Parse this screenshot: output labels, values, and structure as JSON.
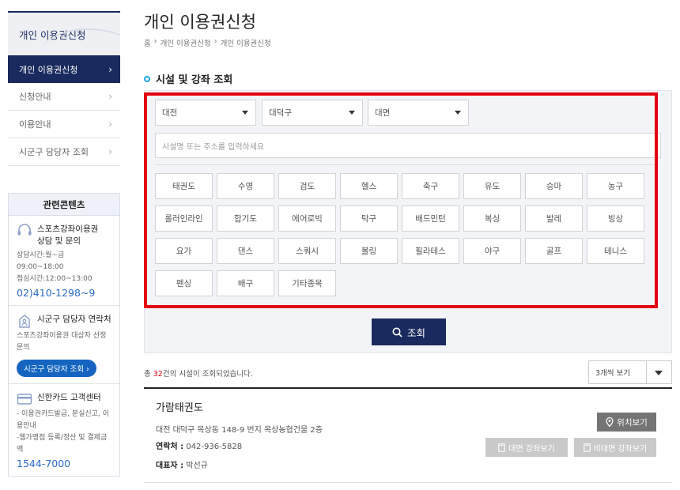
{
  "sidebar": {
    "title": "개인 이용권신청",
    "items": [
      {
        "label": "개인 이용권신청"
      },
      {
        "label": "신청안내"
      },
      {
        "label": "이용안내"
      },
      {
        "label": "시군구 담당자 조회"
      }
    ],
    "chevron": "›",
    "related": {
      "title": "관련콘텐츠",
      "consult": {
        "icon": "headset-icon",
        "name_line1": "스포츠강좌이용권",
        "name_line2": "상담 및 문의",
        "hours1": "상담시간:월~금 09:00~18:00",
        "hours2": "점심시간:12:00~13:00",
        "phone": "02)410-1298~9"
      },
      "district": {
        "icon": "building-icon",
        "name": "시군구 담당자 연락처",
        "desc": "스포츠강좌이용권 대상자 선정 문의",
        "button": "시군구 담당자 조회 ›"
      },
      "card": {
        "icon": "card-icon",
        "name": "신한카드 고객센터",
        "desc1": "- 이용권카드발급, 분실신고, 이용안내",
        "desc2": "-웹가맹점 등록/정산 및 결제금액",
        "phone": "1544-7000"
      }
    }
  },
  "page": {
    "title": "개인 이용권신청",
    "breadcrumb": [
      "홈",
      "개인 이용권신청",
      "개인 이용권신청"
    ],
    "section_title": "시설 및 강좌 조회"
  },
  "search": {
    "region1": "대전",
    "region2": "대덕구",
    "region3": "대면",
    "keyword_placeholder": "시설명 또는 주소를 입력하세요",
    "sports": [
      "태권도",
      "수영",
      "검도",
      "헬스",
      "축구",
      "유도",
      "승마",
      "농구",
      "롤러인라인",
      "합기도",
      "에어로빅",
      "탁구",
      "배드민턴",
      "복싱",
      "발레",
      "빙상",
      "요가",
      "댄스",
      "스쿼시",
      "볼링",
      "필라테스",
      "야구",
      "골프",
      "테니스",
      "펜싱",
      "배구",
      "기타종목"
    ],
    "button_label": "조회"
  },
  "results": {
    "prefix": "총 ",
    "count": "32",
    "suffix": "건의 시설이 조회되었습니다.",
    "view_option": "3개씩 보기",
    "items": [
      {
        "name": "가람태권도",
        "address": "대전 대덕구 목상동 148-9 번지 목상농협건물 2층",
        "contact_label": "연락처 :",
        "contact": "042-936-5828",
        "rep_label": "대표자 :",
        "rep": "박선규",
        "map_button": "위치보기",
        "offline_button": "대면 강좌보기",
        "online_button": "비대면 강좌보기"
      }
    ]
  },
  "colors": {
    "navy": "#1a2a5e",
    "red": "#e3000f",
    "accent": "#1aa4e0"
  }
}
